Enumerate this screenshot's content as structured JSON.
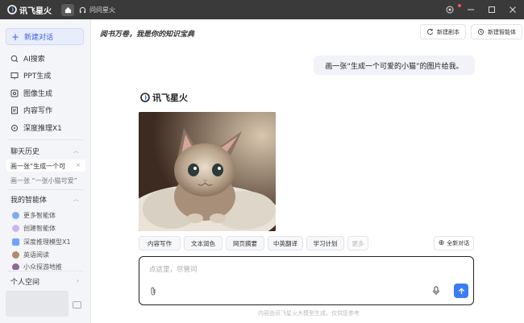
{
  "titlebar": {
    "app_name": "讯飞星火",
    "tab_label": "问问星火",
    "buttons": [
      "bell-icon",
      "minimize-icon",
      "maximize-icon",
      "close-icon"
    ]
  },
  "sidebar": {
    "new_chat": "新建对话",
    "nav": [
      {
        "label": "AI搜索",
        "icon": "search-icon"
      },
      {
        "label": "PPT生成",
        "icon": "ppt-icon"
      },
      {
        "label": "图像生成",
        "icon": "image-icon"
      },
      {
        "label": "内容写作",
        "icon": "write-icon"
      },
      {
        "label": "深度推理X1",
        "icon": "reasoning-icon"
      }
    ],
    "history_title": "聊天历史",
    "history": [
      "画一张“生成一个可",
      "画一张 “一张小猫可爱”"
    ],
    "agents_title": "我的智能体",
    "agents": [
      "更多智能体",
      "创建智能体",
      "深度推理模型X1",
      "英语阅读",
      "小众探游地推"
    ],
    "personal_space": "个人空间"
  },
  "main": {
    "slogan": "阅书万卷，我是你的知识宝典",
    "new_script": "新建剧本",
    "new_agent": "新建智能体",
    "user_message": "画一张“生成一个可爱的小猫”的图片给我。",
    "brand": "讯飞星火",
    "chips": [
      "内容写作",
      "文本润色",
      "网页摘要",
      "中英翻译",
      "学习计划",
      "更多"
    ],
    "new_dialog": "全新对话",
    "input_placeholder": "点这里，尽管问",
    "footer": "内容由讯飞星火大模型生成，仅供您参考"
  },
  "colors": {
    "accent": "#3b62e0",
    "send": "#3b7bf5",
    "titlebar": "#3a3a3a",
    "sidebar_bg": "#f4f5f8"
  }
}
